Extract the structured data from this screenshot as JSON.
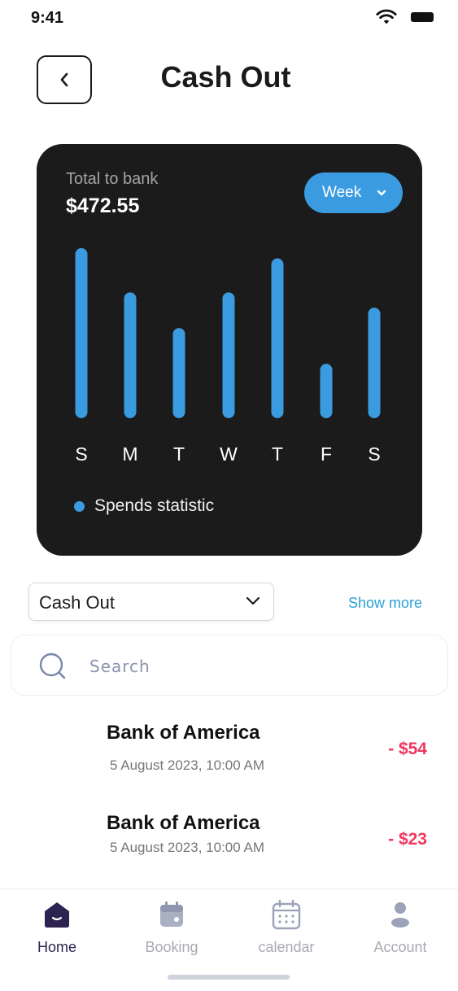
{
  "status_bar": {
    "time": "9:41"
  },
  "header": {
    "title": "Cash Out"
  },
  "summary": {
    "label": "Total to bank",
    "amount": "$472.55",
    "period": "Week"
  },
  "chart_data": {
    "type": "bar",
    "categories": [
      "S",
      "M",
      "T",
      "W",
      "T",
      "F",
      "S"
    ],
    "series": [
      {
        "name": "Spends statistic",
        "values": [
          100,
          74,
          53,
          74,
          94,
          32,
          65
        ]
      }
    ],
    "legend": "bottom-left",
    "grid": false,
    "color": "#3b9be0"
  },
  "filter": {
    "selected": "Cash Out",
    "show_more": "Show more"
  },
  "search": {
    "placeholder": "Search"
  },
  "transactions": [
    {
      "name": "Bank of America",
      "date": "5 August 2023, 10:00 AM",
      "amount": "- $54"
    },
    {
      "name": "Bank of America",
      "date": "5 August 2023, 10:00 AM",
      "amount": "- $23"
    }
  ],
  "tabs": [
    {
      "label": "Home",
      "icon": "home-icon",
      "active": true
    },
    {
      "label": "Booking",
      "icon": "booking-icon",
      "active": false
    },
    {
      "label": "calendar",
      "icon": "calendar-icon",
      "active": false
    },
    {
      "label": "Account",
      "icon": "account-icon",
      "active": false
    }
  ],
  "colors": {
    "accent": "#3b9be0",
    "card_bg": "#1b1b1b",
    "negative": "#f0375e",
    "link": "#2e9fd6",
    "active_tab": "#2c2350"
  }
}
